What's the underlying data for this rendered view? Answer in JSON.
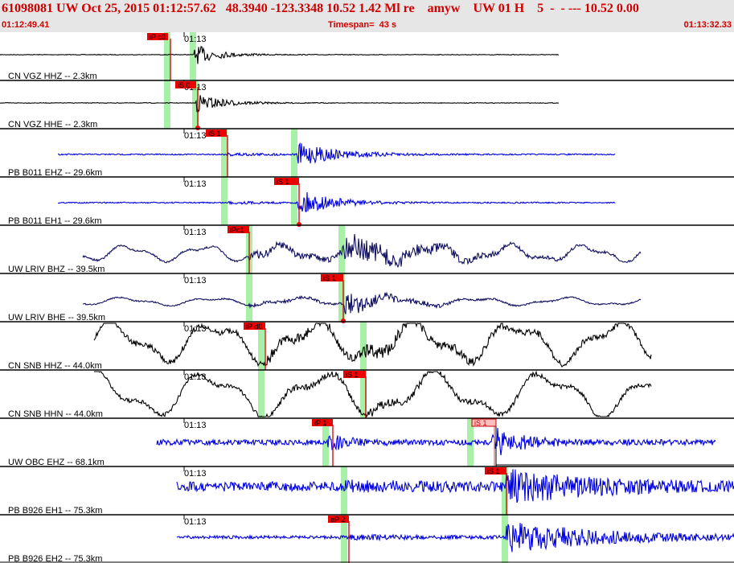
{
  "header": {
    "title": "61098081 UW Oct 25, 2015 01:12:57.62   48.3940 -123.3348 10.52 1.42 Ml re    amyw    UW 01 H    5  -  - --- 10.52 0.00",
    "start_time": "01:12:49.41",
    "timespan": "Timespan=  43 s",
    "end_time": "01:13:32.33"
  },
  "colors": {
    "header_text": "#d00000",
    "pick_red": "#ee0000",
    "pick_pink": "#ffbcbc",
    "window_green": "#a8f0a8",
    "trace_black": "#000000",
    "trace_blue": "#0000e0",
    "trace_navy": "#101060"
  },
  "time_tick_label": "01:13",
  "channels": [
    {
      "label": "CN VGZ HHZ -- 2.3km",
      "color": "#000000",
      "picks": [
        {
          "text": "iP c0"
        }
      ]
    },
    {
      "label": "CN VGZ HHE -- 2.3km",
      "color": "#000000",
      "picks": [
        {
          "text": "iS 0"
        }
      ]
    },
    {
      "label": "PB B011 EHZ -- 29.6km",
      "color": "#0000e0",
      "picks": [
        {
          "text": "iS 1"
        }
      ]
    },
    {
      "label": "PB B011 EH1 -- 29.6km",
      "color": "#0000e0",
      "picks": [
        {
          "text": "iS 1"
        }
      ]
    },
    {
      "label": "UW LRIV BHZ -- 39.5km",
      "color": "#101060",
      "picks": [
        {
          "text": "iPc1"
        }
      ]
    },
    {
      "label": "UW LRIV BHE -- 39.5km",
      "color": "#101060",
      "picks": [
        {
          "text": "iS 1"
        }
      ]
    },
    {
      "label": "CN SNB HHZ -- 44.0km",
      "color": "#000000",
      "picks": [
        {
          "text": "iP d0"
        }
      ]
    },
    {
      "label": "CN SNB HHN -- 44.0km",
      "color": "#000000",
      "picks": [
        {
          "text": "iS 1"
        }
      ]
    },
    {
      "label": "UW OBC EHZ -- 68.1km",
      "color": "#0000e0",
      "picks": [
        {
          "text": "iP 1"
        },
        {
          "text": "iS 1"
        }
      ]
    },
    {
      "label": "PB B926 EH1 -- 75.3km",
      "color": "#0000e0",
      "picks": [
        {
          "text": "iS 1"
        }
      ]
    },
    {
      "label": "PB B926 EH2 -- 75.3km",
      "color": "#0000e0",
      "picks": [
        {
          "text": "eP 2"
        }
      ]
    }
  ]
}
